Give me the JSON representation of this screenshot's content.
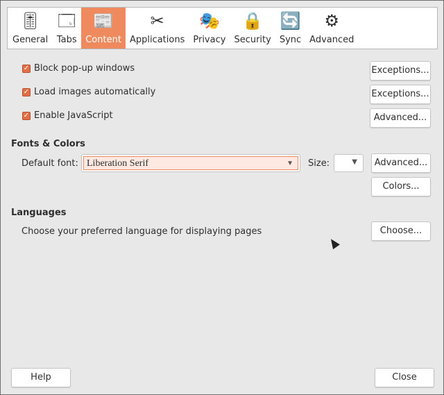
{
  "tabs": [
    {
      "label": "General",
      "icon": "sliders-icon",
      "glyph": "🎚"
    },
    {
      "label": "Tabs",
      "icon": "window-tabs-icon",
      "glyph": "🗔"
    },
    {
      "label": "Content",
      "icon": "content-icon",
      "glyph": "📰",
      "active": true
    },
    {
      "label": "Applications",
      "icon": "applications-icon",
      "glyph": "✂"
    },
    {
      "label": "Privacy",
      "icon": "mask-icon",
      "glyph": "🎭"
    },
    {
      "label": "Security",
      "icon": "lock-icon",
      "glyph": "🔒"
    },
    {
      "label": "Sync",
      "icon": "sync-icon",
      "glyph": "🔄"
    },
    {
      "label": "Advanced",
      "icon": "gear-icon",
      "glyph": "⚙"
    }
  ],
  "checkboxes": [
    {
      "label": "Block pop-up windows",
      "checked": true,
      "button": "Exceptions..."
    },
    {
      "label": "Load images automatically",
      "checked": true,
      "button": "Exceptions..."
    },
    {
      "label": "Enable JavaScript",
      "checked": true,
      "button": "Advanced..."
    }
  ],
  "fonts": {
    "heading": "Fonts & Colors",
    "default_font_label": "Default font:",
    "default_font_value": "Liberation Serif",
    "size_label": "Size:",
    "size_value": "",
    "advanced_button": "Advanced...",
    "colors_button": "Colors..."
  },
  "languages": {
    "heading": "Languages",
    "description": "Choose your preferred language for displaying pages",
    "choose_button": "Choose..."
  },
  "footer": {
    "help": "Help",
    "close": "Close"
  },
  "accent": "#ef8a5e"
}
